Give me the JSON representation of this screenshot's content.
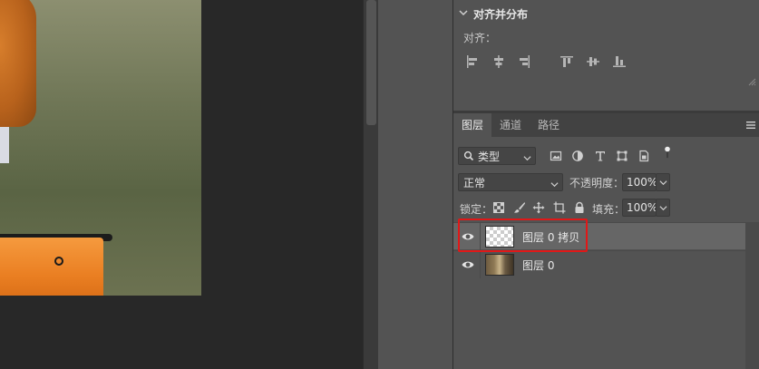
{
  "align_panel": {
    "title": "对齐并分布",
    "align_label": "对齐：",
    "buttons": [
      "align-left-edges",
      "align-horizontal-centers",
      "align-right-edges",
      "align-top-edges",
      "align-vertical-centers",
      "align-bottom-edges"
    ]
  },
  "layers_panel": {
    "tabs": [
      {
        "label": "图层",
        "active": true
      },
      {
        "label": "通道",
        "active": false
      },
      {
        "label": "路径",
        "active": false
      }
    ],
    "filter": {
      "selected": "类型"
    },
    "blend_mode": "正常",
    "opacity_label": "不透明度：",
    "opacity_value": "100%",
    "lock_label": "锁定：",
    "fill_label": "填充：",
    "fill_value": "100%",
    "layers": [
      {
        "name": "图层 0 拷贝",
        "visible": true,
        "selected": true,
        "thumbnail": "transparent"
      },
      {
        "name": "图层 0",
        "visible": true,
        "selected": false,
        "thumbnail": "photo"
      }
    ]
  },
  "colors": {
    "panel_bg": "#535353",
    "tab_bar": "#424242",
    "selected_row": "#666666",
    "highlight": "#e01818",
    "canvas_bg": "#282828"
  }
}
